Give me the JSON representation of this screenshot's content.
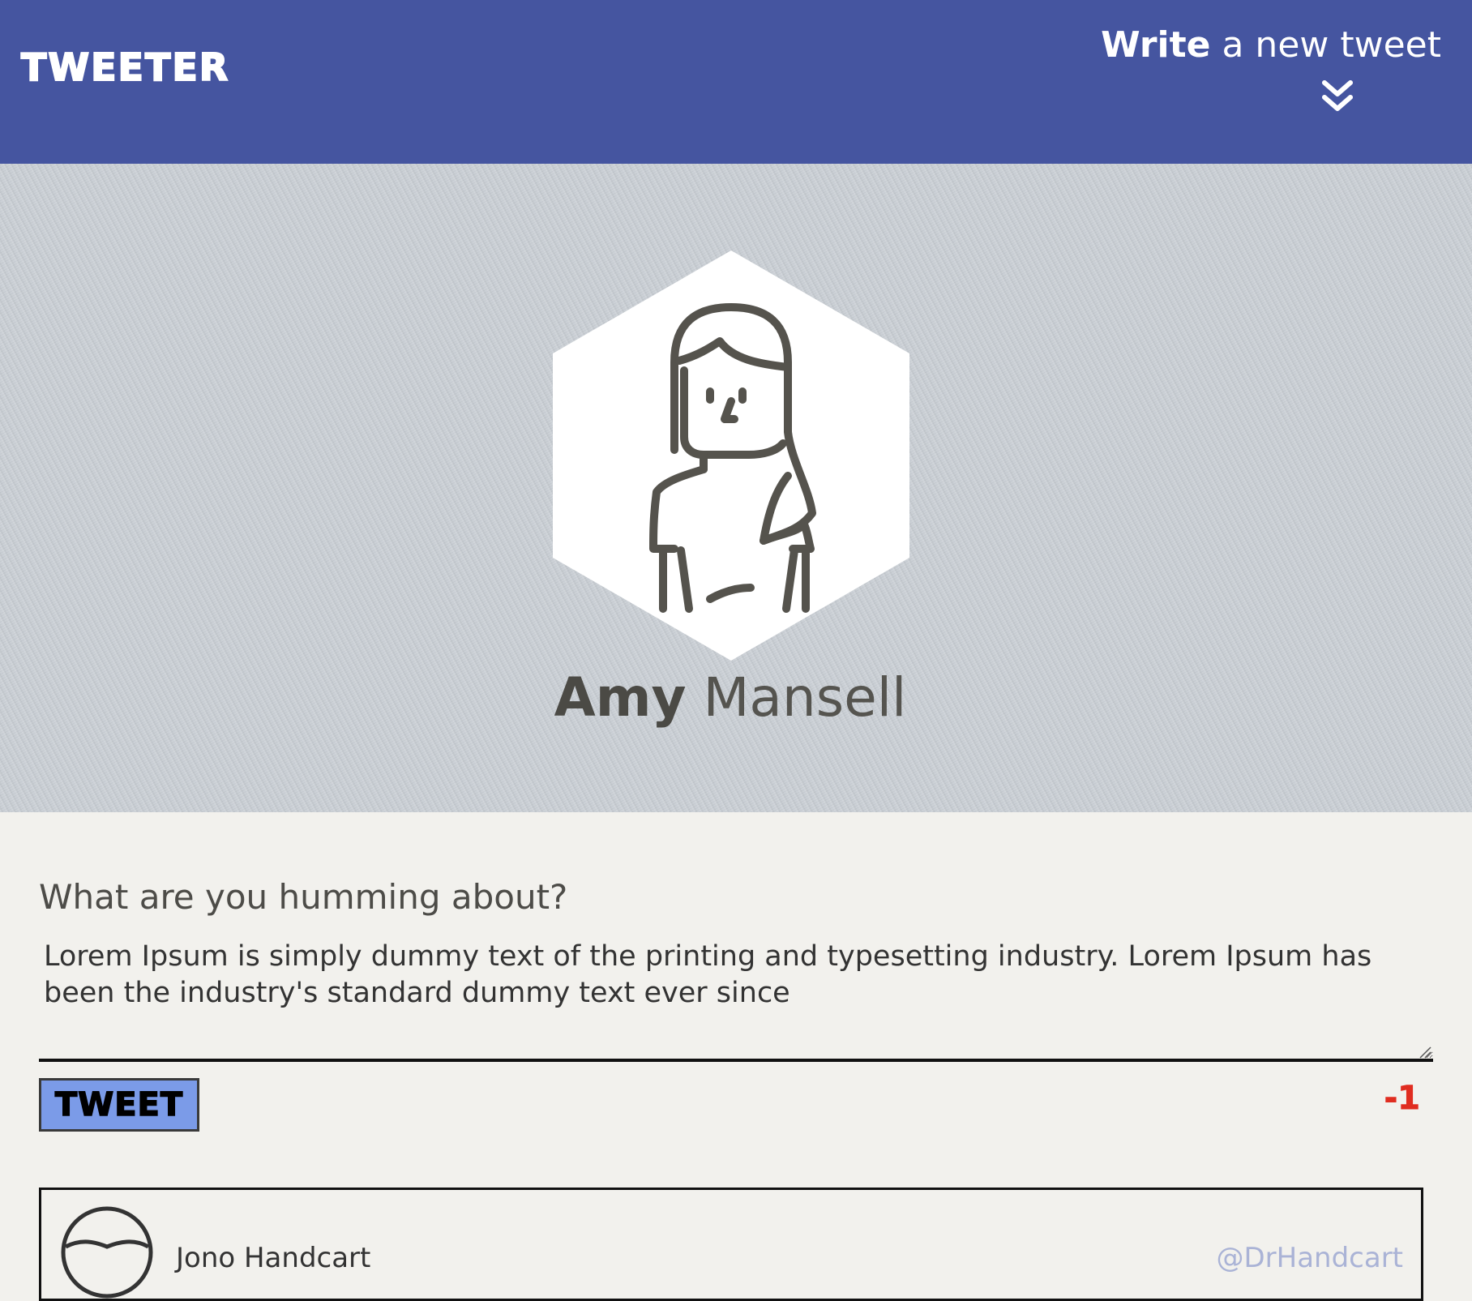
{
  "nav": {
    "logo": "TWEETER",
    "compose_bold": "Write",
    "compose_rest": " a new tweet",
    "chevron_icon": "double-chevron-down-icon"
  },
  "profile": {
    "first_name": "Amy",
    "last_name": "Mansell",
    "avatar_icon": "woman-avatar-icon"
  },
  "compose": {
    "label": "What are you humming about?",
    "text": "Lorem Ipsum is simply dummy text of the printing and typesetting industry. Lorem Ipsum has been the industry's standard dummy text ever since",
    "button_label": "TWEET",
    "counter": "-1"
  },
  "tweets": [
    {
      "author": "Jono Handcart",
      "handle": "@DrHandcart",
      "avatar_icon": "user-avatar-icon"
    }
  ],
  "colors": {
    "nav_bg": "#4555a0",
    "page_bg": "#f2f1ed",
    "button_bg": "#7b9be8",
    "counter": "#e02d20"
  }
}
